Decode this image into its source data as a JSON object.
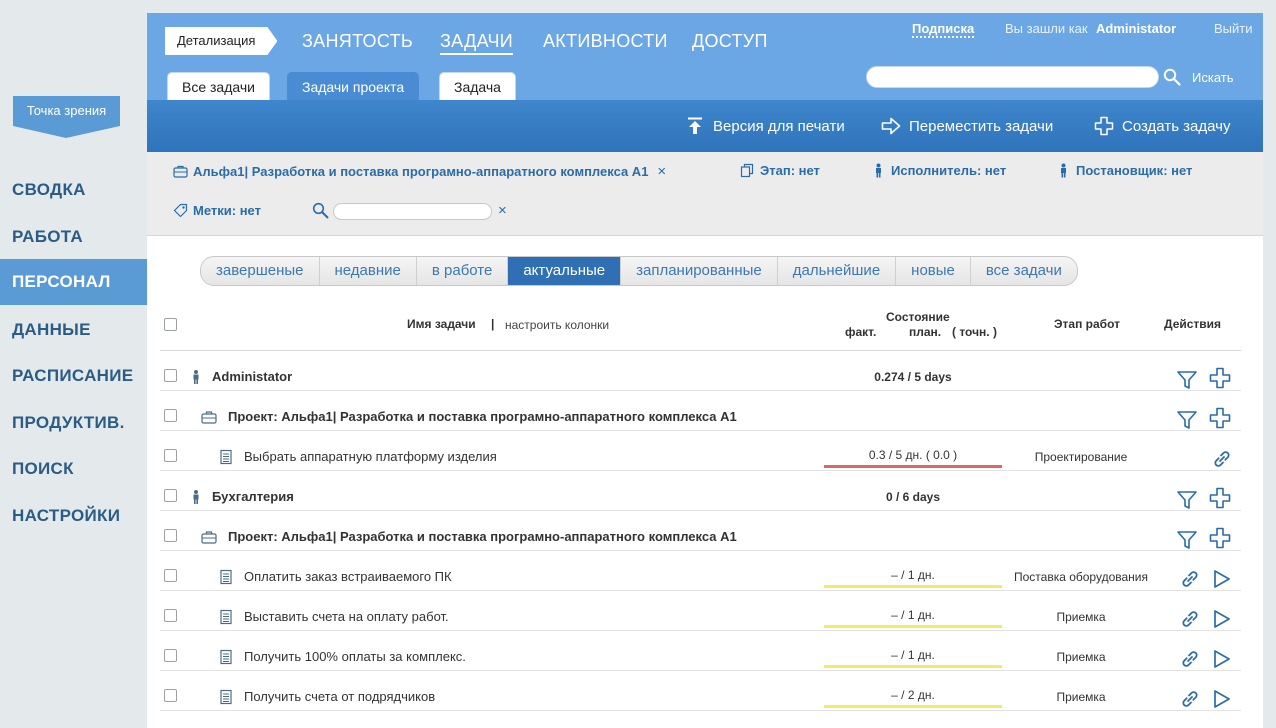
{
  "sidebar": {
    "viewpoint_label": "Точка зрения",
    "items": [
      {
        "label": "СВОДКА"
      },
      {
        "label": "РАБОТА"
      },
      {
        "label": "ПЕРСОНАЛ"
      },
      {
        "label": "ДАННЫЕ"
      },
      {
        "label": "РАСПИСАНИЕ"
      },
      {
        "label": "ПРОДУКТИВ."
      },
      {
        "label": "ПОИСК"
      },
      {
        "label": "НАСТРОЙКИ"
      }
    ],
    "active_index": 2
  },
  "header": {
    "detail_label": "Детализация",
    "nav": [
      {
        "label": "ЗАНЯТОСТЬ"
      },
      {
        "label": "ЗАДАЧИ"
      },
      {
        "label": "АКТИВНОСТИ"
      },
      {
        "label": "ДОСТУП"
      }
    ],
    "active_nav_index": 1,
    "subscription": "Подписка",
    "logged_as_label": "Вы зашли как",
    "user": "Administator",
    "logout": "Выйти",
    "search_placeholder": "",
    "search_label": "Искать",
    "tabs": [
      {
        "label": "Все задачи"
      },
      {
        "label": "Задачи проекта"
      },
      {
        "label": "Задача"
      }
    ],
    "active_tab_index": 1
  },
  "actions": {
    "print": "Версия для печати",
    "move": "Переместить задачи",
    "create": "Создать задачу"
  },
  "filters": {
    "project": "Альфа1| Разработка и поставка програмно-аппаратного комплекса А1",
    "stage": "Этап: нет",
    "executor": "Исполнитель: нет",
    "creator": "Постановщик: нет",
    "tags": "Метки: нет",
    "clear_symbol": "×"
  },
  "segments": {
    "items": [
      "завершеные",
      "недавние",
      "в работе",
      "актуальные",
      "запланированные",
      "дальнейшие",
      "новые",
      "все задачи"
    ],
    "active_index": 3
  },
  "table": {
    "headers": {
      "task_name": "Имя задачи",
      "separator": "|",
      "configure": "настроить колонки",
      "state": "Состояние",
      "fact": "факт.",
      "plan": "план.",
      "exact": "( точн. )",
      "stage": "Этап работ",
      "actions": "Действия"
    },
    "rows": [
      {
        "kind": "user",
        "title": "Administator",
        "total": "0.274 / 5 days"
      },
      {
        "kind": "project",
        "title": "Проект:  Альфа1| Разработка и поставка програмно-аппаратного комплекса А1"
      },
      {
        "kind": "task",
        "title": "Выбрать аппаратную платформу изделия",
        "state": "0.3 / 5 дн. ( 0.0 )",
        "bar_color": "#e06666",
        "stage": "Проектирование",
        "play": false
      },
      {
        "kind": "user",
        "title": "Бухгалтерия",
        "total": "0 / 6 days"
      },
      {
        "kind": "project",
        "title": "Проект:  Альфа1| Разработка и поставка програмно-аппаратного комплекса А1"
      },
      {
        "kind": "task",
        "title": "Оплатить заказ встраиваемого ПК",
        "state": "– / 1 дн.",
        "bar_color": "#f0ec6a",
        "stage": "Поставка оборудования",
        "play": true
      },
      {
        "kind": "task",
        "title": "Выставить счета на оплату работ.",
        "state": "– / 1 дн.",
        "bar_color": "#f0ec6a",
        "stage": "Приемка",
        "play": true
      },
      {
        "kind": "task",
        "title": "Получить 100% оплаты за комплекс.",
        "state": "– / 1 дн.",
        "bar_color": "#f0ec6a",
        "stage": "Приемка",
        "play": true
      },
      {
        "kind": "task",
        "title": "Получить счета от подрядчиков",
        "state": "– / 2 дн.",
        "bar_color": "#f0ec6a",
        "stage": "Приемка",
        "play": true
      }
    ]
  },
  "colors": {
    "accent": "#5b9bd5",
    "topbar": "#6aa7e4",
    "actionbar": "#2f74ba",
    "link": "#2a6ca8",
    "overdue_bar": "#e06666",
    "pending_bar": "#f0ec6a"
  }
}
